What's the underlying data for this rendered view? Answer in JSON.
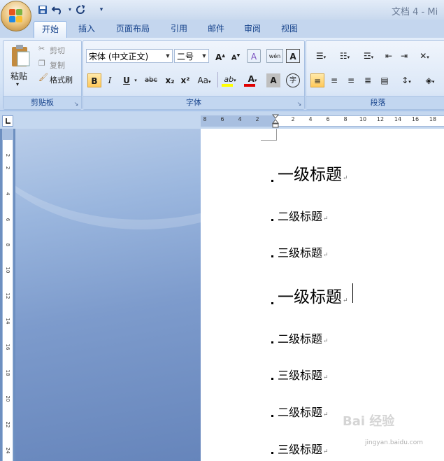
{
  "window": {
    "title": "文档 4 - Mi"
  },
  "quick_access": {
    "save_icon": "save-icon",
    "undo_icon": "undo-icon",
    "redo_icon": "redo-icon",
    "customize": "▾"
  },
  "tabs": [
    "开始",
    "插入",
    "页面布局",
    "引用",
    "邮件",
    "审阅",
    "视图"
  ],
  "active_tab": "开始",
  "clipboard": {
    "paste_label": "粘贴",
    "cut_label": "剪切",
    "copy_label": "复制",
    "format_painter_label": "格式刷",
    "group_label": "剪贴板"
  },
  "font": {
    "font_name": "宋体 (中文正文)",
    "font_size": "二号",
    "grow": "A",
    "shrink": "A",
    "clear": "A",
    "phonetic": "wén",
    "border": "A",
    "bold": "B",
    "italic": "I",
    "underline": "U",
    "strikethrough": "abc",
    "subscript": "x₂",
    "superscript": "x²",
    "change_case": "Aa",
    "highlight": "ab",
    "font_color": "A",
    "shading": "A",
    "enclose": "字",
    "group_label": "字体",
    "highlight_color": "#ffff00",
    "font_color_value": "#e00000"
  },
  "paragraph": {
    "group_label": "段落"
  },
  "ruler": {
    "h_marks": [
      "8",
      "6",
      "4",
      "2",
      "2",
      "4",
      "6",
      "8",
      "10",
      "12",
      "14",
      "16",
      "18"
    ],
    "v_marks": [
      "2",
      "2",
      "4",
      "6",
      "8",
      "10",
      "12",
      "14",
      "16",
      "18",
      "20",
      "22",
      "24"
    ]
  },
  "document": {
    "headings": [
      {
        "level": "h1",
        "text": "一级标题"
      },
      {
        "level": "h2",
        "text": "二级标题"
      },
      {
        "level": "h3",
        "text": "三级标题"
      },
      {
        "level": "h1",
        "text": "一级标题"
      },
      {
        "level": "h2",
        "text": "二级标题"
      },
      {
        "level": "h3",
        "text": "三级标题"
      },
      {
        "level": "h2",
        "text": "二级标题"
      },
      {
        "level": "h3",
        "text": "三级标题"
      }
    ],
    "paragraph_mark": "↵"
  },
  "watermark": {
    "text": "Bai 经验",
    "url": "jingyan.baidu.com"
  }
}
